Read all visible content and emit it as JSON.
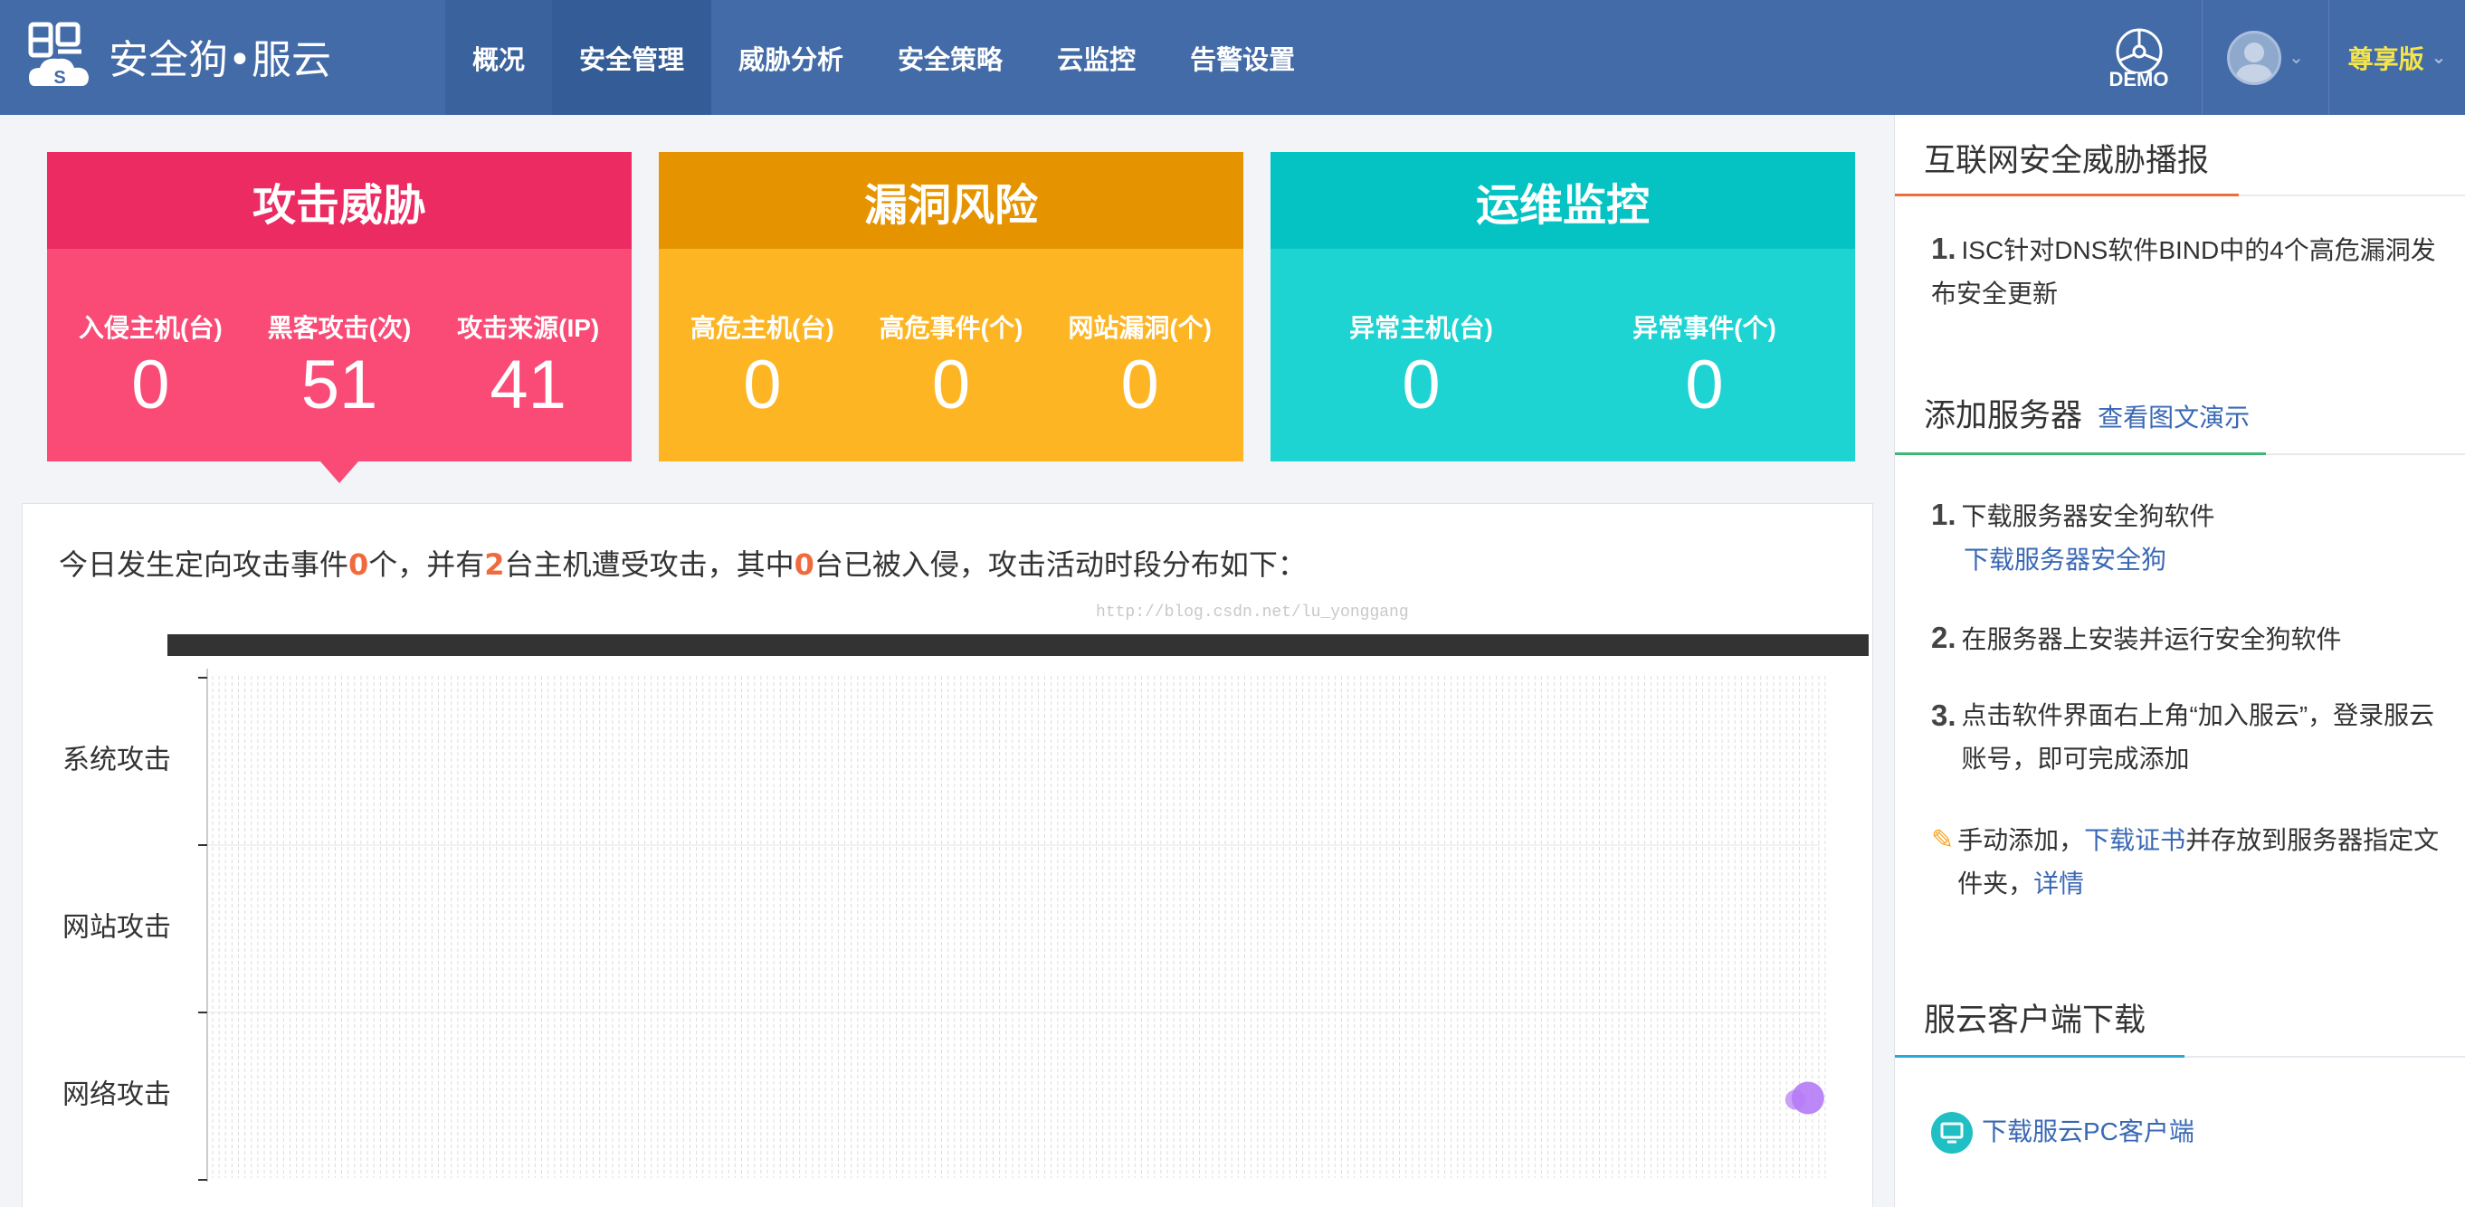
{
  "brand": {
    "name": "安全狗•服云"
  },
  "nav": {
    "items": [
      {
        "label": "概况"
      },
      {
        "label": "安全管理"
      },
      {
        "label": "威胁分析"
      },
      {
        "label": "安全策略"
      },
      {
        "label": "云监控"
      },
      {
        "label": "告警设置"
      }
    ],
    "demo_label": "DEMO",
    "edition_label": "尊享版"
  },
  "cards": [
    {
      "title": "攻击威胁",
      "color": "#fa4b77",
      "stats": [
        {
          "label": "入侵主机(台)",
          "value": "0"
        },
        {
          "label": "黑客攻击(次)",
          "value": "51"
        },
        {
          "label": "攻击来源(IP)",
          "value": "41"
        }
      ]
    },
    {
      "title": "漏洞风险",
      "color": "#fdb523",
      "stats": [
        {
          "label": "高危主机(台)",
          "value": "0"
        },
        {
          "label": "高危事件(个)",
          "value": "0"
        },
        {
          "label": "网站漏洞(个)",
          "value": "0"
        }
      ]
    },
    {
      "title": "运维监控",
      "color": "#1dd4d2",
      "stats": [
        {
          "label": "异常主机(台)",
          "value": "0"
        },
        {
          "label": "异常事件(个)",
          "value": "0"
        }
      ]
    }
  ],
  "summary": {
    "p1": "今日发生定向攻击事件",
    "n1": "0",
    "p2": "个，并有",
    "n2": "2",
    "p3": "台主机遭受攻击，其中",
    "n3": "0",
    "p4": "台已被入侵，攻击活动时段分布如下："
  },
  "watermark": "http://blog.csdn.net/lu_yonggang",
  "chart_data": {
    "type": "scatter",
    "categories": [
      "系统攻击",
      "网站攻击",
      "网络攻击"
    ],
    "x_ticks": 250,
    "points": [
      {
        "category": "网络攻击",
        "x": 249,
        "size": 1,
        "color": "#b57af5"
      }
    ]
  },
  "sidebar": {
    "news": {
      "title": "互联网安全威胁播报",
      "items": [
        {
          "num": "1.",
          "text": "ISC针对DNS软件BIND中的4个高危漏洞发布安全更新"
        }
      ]
    },
    "add_server": {
      "title": "添加服务器",
      "demo_link": "查看图文演示",
      "steps": [
        {
          "num": "1.",
          "text": "下载服务器安全狗软件",
          "link": "下载服务器安全狗"
        },
        {
          "num": "2.",
          "text": "在服务器上安装并运行安全狗软件"
        },
        {
          "num": "3.",
          "text": "点击软件界面右上角“加入服云”，登录服云账号，即可完成添加"
        }
      ],
      "manual": {
        "p1": "手动添加，",
        "link1": "下载证书",
        "p2": "并存放到服务器指定文件夹，",
        "link2": "详情"
      }
    },
    "client": {
      "title": "服云客户端下载",
      "link": "下载服云PC客户端"
    }
  }
}
